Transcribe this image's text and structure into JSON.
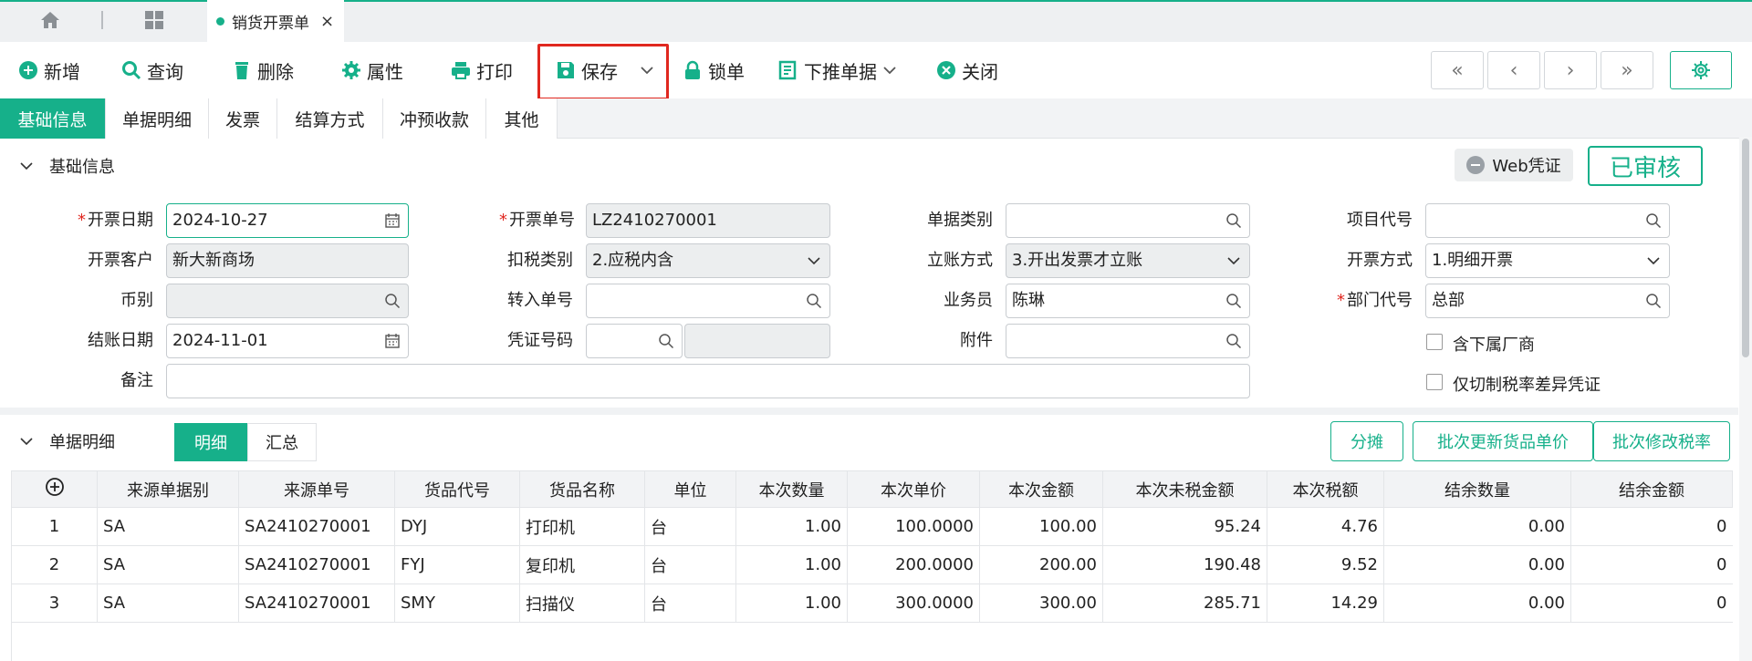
{
  "tabbar": {
    "doc_tab_label": "销货开票单",
    "close": "×"
  },
  "toolbar": {
    "add": "新增",
    "query": "查询",
    "delete": "删除",
    "props": "属性",
    "print": "打印",
    "save": "保存",
    "lock": "锁单",
    "push": "下推单据",
    "close": "关闭"
  },
  "nav": {
    "first": "«",
    "prev": "‹",
    "next": "›",
    "last": "»"
  },
  "subtabs": [
    "基础信息",
    "单据明细",
    "发票",
    "结算方式",
    "冲预收款",
    "其他"
  ],
  "basic": {
    "title": "基础信息",
    "web_voucher": "Web凭证",
    "status": "已审核",
    "fields": {
      "invoice_date_label": "开票日期",
      "invoice_date": "2024-10-27",
      "invoice_no_label": "开票单号",
      "invoice_no": "LZ2410270001",
      "doc_type_label": "单据类别",
      "doc_type": "",
      "project_label": "项目代号",
      "project": "",
      "customer_label": "开票客户",
      "customer": "新大新商场",
      "tax_type_label": "扣税类别",
      "tax_type": "2.应税内含",
      "account_label": "立账方式",
      "account": "3.开出发票才立账",
      "invoice_mode_label": "开票方式",
      "invoice_mode": "1.明细开票",
      "currency_label": "币别",
      "currency": "",
      "transfer_label": "转入单号",
      "transfer": "",
      "salesman_label": "业务员",
      "salesman": "陈琳",
      "dept_label": "部门代号",
      "dept": "总部",
      "close_date_label": "结账日期",
      "close_date": "2024-11-01",
      "voucher_label": "凭证号码",
      "voucher_a": "",
      "voucher_b": "",
      "attach_label": "附件",
      "attach": "",
      "remark_label": "备注",
      "remark": "",
      "chk1": "含下属厂商",
      "chk2": "仅切制税率差异凭证"
    }
  },
  "detail": {
    "title": "单据明细",
    "seg_detail": "明细",
    "seg_sum": "汇总",
    "btn_split": "分摊",
    "btn_price": "批次更新货品单价",
    "btn_tax": "批次修改税率",
    "columns": [
      "来源单据别",
      "来源单号",
      "货品代号",
      "货品名称",
      "单位",
      "本次数量",
      "本次单价",
      "本次金额",
      "本次未税金额",
      "本次税额",
      "结余数量",
      "结余金额"
    ],
    "rows": [
      [
        "1",
        "SA",
        "SA2410270001",
        "DYJ",
        "打印机",
        "台",
        "1.00",
        "100.0000",
        "100.00",
        "95.24",
        "4.76",
        "0.00",
        "0"
      ],
      [
        "2",
        "SA",
        "SA2410270001",
        "FYJ",
        "复印机",
        "台",
        "1.00",
        "200.0000",
        "200.00",
        "190.48",
        "9.52",
        "0.00",
        "0"
      ],
      [
        "3",
        "SA",
        "SA2410270001",
        "SMY",
        "扫描仪",
        "台",
        "1.00",
        "300.0000",
        "300.00",
        "285.71",
        "14.29",
        "0.00",
        "0"
      ]
    ]
  },
  "colors": {
    "accent": "#16b08a",
    "highlight": "#e0271f"
  }
}
